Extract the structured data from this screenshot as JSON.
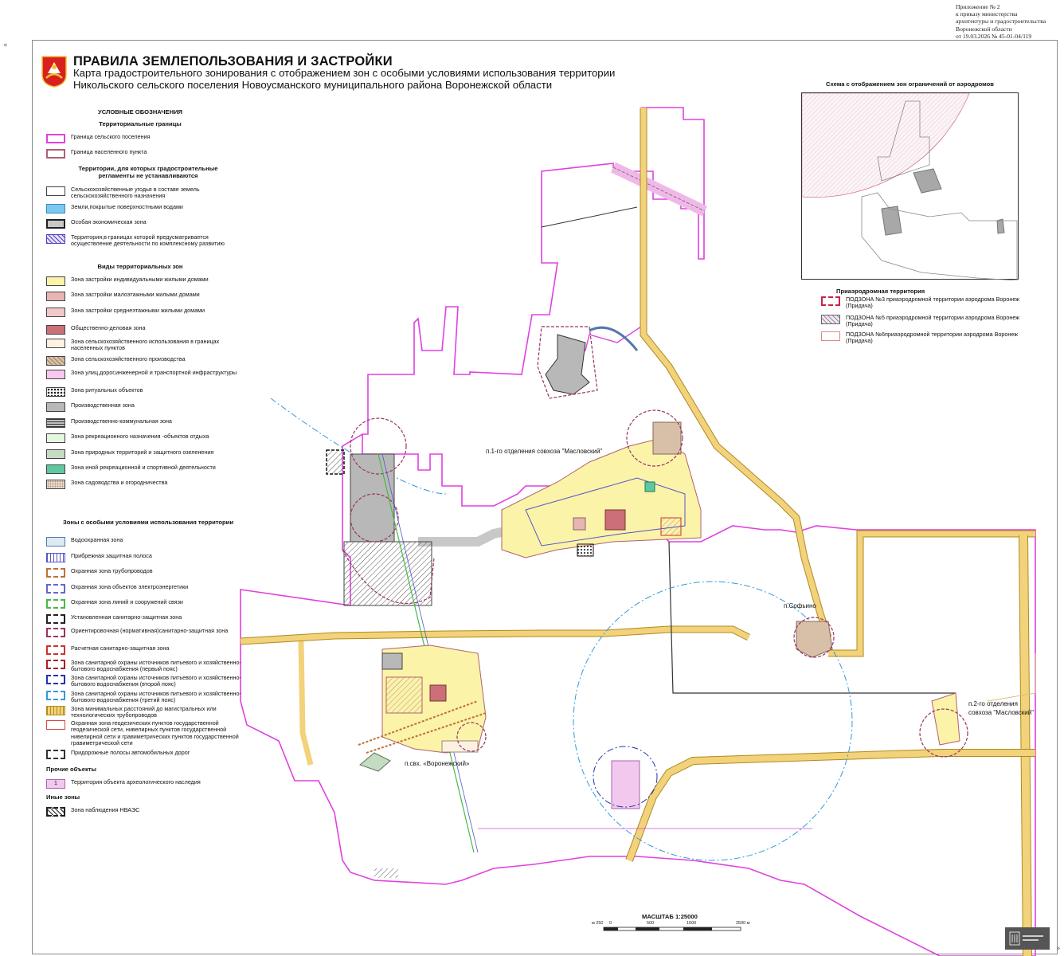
{
  "header": {
    "decree_lines": [
      "Приложение № 2",
      "к приказу министерства",
      "архитектуры и градостроительства",
      "Воронежской области",
      "от 19.03.2026 № 45-01-04/119"
    ],
    "title": "ПРАВИЛА ЗЕМЛЕПОЛЬЗОВАНИЯ И ЗАСТРОЙКИ",
    "subtitle_line1": "Карта градостроительного зонирования с отображением зон с особыми условиями использования территории",
    "subtitle_line2": "Никольского сельского поселения Новоусманского муниципального района Воронежской области"
  },
  "nav": {
    "prev": "«",
    "next": "»"
  },
  "legend": {
    "title": "УСЛОВНЫЕ ОБОЗНАЧЕНИЯ",
    "sections": [
      {
        "heading": "Территориальные границы",
        "items": [
          {
            "label": "Граница сельского поселения",
            "fill": "#ffffff",
            "stroke": "#e040e0"
          },
          {
            "label": "Граница населенного пункта",
            "fill": "#ffffff",
            "stroke": "#b06070"
          }
        ]
      },
      {
        "heading": "Территории, для которых градостроительные регламенты не устанавливаются",
        "items": [
          {
            "label": "Сельскохозяйственные угодья в составе земель сельскохозяйственного назначения",
            "fill": "#ffffff",
            "stroke": "#666666"
          },
          {
            "label": "Земли,покрытые поверхностными водами",
            "fill": "#7cc8f0",
            "stroke": "#3a8ac0"
          },
          {
            "label": "Особая экономическая зона",
            "fill": "#c8c8c8",
            "stroke": "#222222"
          },
          {
            "label": "Территория,в границах которой предусматривается осуществление деятельности по комплексному развитию",
            "fill": "#e6e0f8",
            "stroke": "#5040c0"
          }
        ]
      },
      {
        "heading": "Виды территориальных зон",
        "items": [
          {
            "label": "Зона застройки индивидуальными жилыми домами",
            "fill": "#fbf3a8",
            "stroke": "#888866"
          },
          {
            "label": "Зона застройки малоэтажными жилыми домами",
            "fill": "#e8b4b4",
            "stroke": "#886666"
          },
          {
            "label": "Зона застройки среднеэтажными жилыми домами",
            "fill": "#f0c8c8",
            "stroke": "#886666"
          },
          {
            "label": "Общественно-деловая зона",
            "fill": "#cc6f78",
            "stroke": "#773333"
          },
          {
            "label": "Зона сельскохозяйственного использования в границах населенных пунктов",
            "fill": "#fdf2e2",
            "stroke": "#998877"
          },
          {
            "label": "Зона сельскохозяйственного производства",
            "fill": "#d8c0a8",
            "stroke": "#886655"
          },
          {
            "label": "Зона улиц,дорог,инженерной и транспортной инфраструктуры",
            "fill": "#f8c8f0",
            "stroke": "#aa66aa"
          },
          {
            "label": "Зона ритуальных объектов",
            "fill": "#ffffff",
            "stroke": "#222222"
          },
          {
            "label": "Производственная зона",
            "fill": "#b8b8b8",
            "stroke": "#444444"
          },
          {
            "label": "Производственно-коммунальная зона",
            "fill": "#9a9a9a",
            "stroke": "#444444"
          },
          {
            "label": "Зона рекреационного назначения -объектов отдыха",
            "fill": "#e4f8e0",
            "stroke": "#66aa66"
          },
          {
            "label": "Зона природных территорий и защитного озеленения",
            "fill": "#c6dcc2",
            "stroke": "#557755"
          },
          {
            "label": "Зона иной рекреационной и спортивной деятельности",
            "fill": "#5ec9a0",
            "stroke": "#227755"
          },
          {
            "label": "Зона садоводства и огородничества",
            "fill": "#f0e4d8",
            "stroke": "#998877"
          }
        ]
      },
      {
        "heading": "Зоны с особыми условиями использования территории",
        "items": [
          {
            "label": "Водоохранная зона",
            "fill": "#dceaf6",
            "stroke": "#5577aa"
          },
          {
            "label": "Прибрежная защитная полоса",
            "fill": "#ffffff",
            "stroke": "#5555cc"
          },
          {
            "label": "Охранная зона трубопроводов",
            "fill": "#ffffff",
            "stroke": "#c07030"
          },
          {
            "label": "Охранная зона объектов электроэнергетики",
            "fill": "#ffffff",
            "stroke": "#6666cc"
          },
          {
            "label": "Охранная зона линий и сооружений связи",
            "fill": "#ffffff",
            "stroke": "#44bb44"
          },
          {
            "label": "Установленная санитарно-защитная зона",
            "fill": "#ffffff",
            "stroke": "#222222"
          },
          {
            "label": "Ориентировочная (нормативная)санитарно-защитная зона",
            "fill": "#ffffff",
            "stroke": "#993366"
          },
          {
            "label": "Расчетная санитарно-защитная зона",
            "fill": "#ffffff",
            "stroke": "#cc3333"
          },
          {
            "label": "Зона санитарной охраны источников питьевого и хозяйственно-бытового водоснабжения (первый пояс)",
            "fill": "#ffffff",
            "stroke": "#aa2222"
          },
          {
            "label": "Зона санитарной охраны источников питьевого и хозяйственно-бытового водоснабжения (второй пояс)",
            "fill": "#ffffff",
            "stroke": "#2233aa"
          },
          {
            "label": "Зона санитарной охраны источников питьевого и хозяйственно-бытового водоснабжения (третий пояс)",
            "fill": "#ffffff",
            "stroke": "#3399dd"
          },
          {
            "label": "Зона минимальных расстояний до магистральных или технологических трубопроводов",
            "fill": "#f2d27a",
            "stroke": "#b08a20"
          },
          {
            "label": "Охранная зона геодезических пунктов государственной геодезической сети, нивелирных пунктов государственной нивелирной сети и гравиметрических пунктов государственной гравиметрической сети",
            "fill": "#ffffff",
            "stroke": "#dd4444"
          },
          {
            "label": "Придорожные полосы автомобильных дорог",
            "fill": "#ffffff",
            "stroke": "#333333"
          }
        ]
      },
      {
        "heading": "Прочие объекты",
        "items": [
          {
            "label": "Территория объекта археологического наследия",
            "fill": "#f3c8ef",
            "stroke": "#aa66aa",
            "badge": "1"
          }
        ]
      },
      {
        "heading": "Иные зоны",
        "items": [
          {
            "label": "Зона наблюдения НВАЭС",
            "fill": "#ffffff",
            "stroke": "#222222"
          }
        ]
      }
    ]
  },
  "map": {
    "labels": {
      "settlement1": "п.1-го отделения совхоза \"Масловский\"",
      "settlement2": "п.Софьино",
      "settlement3": "п.свх. «Воронежский»",
      "settlement4_line1": "п.2-го отделения",
      "settlement4_line2": "совхоза \"Масловский\""
    }
  },
  "inset": {
    "title": "Схема с отображением зон ограничений от аэродромов"
  },
  "airport_legend": {
    "title": "Приаэродромная территория",
    "items": [
      {
        "label": "ПОДЗОНА №3 приаэродромной территории аэродрома Воронеж (Придача)",
        "fill": "#ffffff",
        "stroke": "#cc2244"
      },
      {
        "label": "ПОДЗОНА №5 приаэродромной территории аэродрома Воронеж (Придача)",
        "fill": "#f0e8f0",
        "stroke": "#666666"
      },
      {
        "label": "ПОДЗОНА №6приаэродромной территории аэродрома Воронеж (Придача)",
        "fill": "#ffffff",
        "stroke": "#dd8888"
      }
    ]
  },
  "scale": {
    "title": "МАСШТАБ 1:25000",
    "ticks": [
      "м 250",
      "0",
      "500",
      "1500",
      "2500 м"
    ]
  },
  "colors": {
    "boundary": "#e040e0",
    "pipeline_zone": "#f2d27a",
    "pipeline_border": "#b08a20",
    "residential": "#fbf3a8",
    "industrial": "#b8b8b8",
    "road": "#cfcfcf"
  }
}
